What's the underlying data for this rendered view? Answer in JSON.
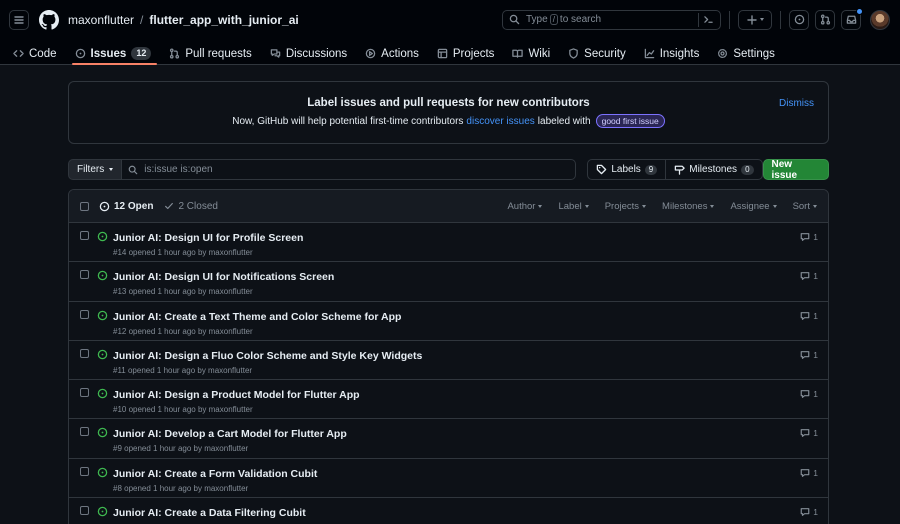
{
  "header": {
    "owner": "maxonflutter",
    "separator": "/",
    "repo": "flutter_app_with_junior_ai",
    "search": {
      "prefix": "Type",
      "key": "/",
      "suffix": "to search"
    }
  },
  "nav": {
    "tabs": [
      {
        "label": "Code"
      },
      {
        "label": "Issues",
        "count": "12"
      },
      {
        "label": "Pull requests"
      },
      {
        "label": "Discussions"
      },
      {
        "label": "Actions"
      },
      {
        "label": "Projects"
      },
      {
        "label": "Wiki"
      },
      {
        "label": "Security"
      },
      {
        "label": "Insights"
      },
      {
        "label": "Settings"
      }
    ]
  },
  "banner": {
    "title": "Label issues and pull requests for new contributors",
    "text_before": "Now, GitHub will help potential first-time contributors",
    "link": "discover issues",
    "text_after": "labeled with",
    "label": "good first issue",
    "dismiss": "Dismiss"
  },
  "filterbar": {
    "filters": "Filters",
    "query": "is:issue is:open",
    "labels": "Labels",
    "labels_count": "9",
    "milestones": "Milestones",
    "milestones_count": "0",
    "new_issue": "New issue"
  },
  "list": {
    "open": "12 Open",
    "closed": "2 Closed",
    "sorts": [
      "Author",
      "Label",
      "Projects",
      "Milestones",
      "Assignee",
      "Sort"
    ],
    "issues": [
      {
        "title": "Junior AI: Design UI for Profile Screen",
        "meta": "#14 opened 1 hour ago by maxonflutter",
        "comments": "1"
      },
      {
        "title": "Junior AI: Design UI for Notifications Screen",
        "meta": "#13 opened 1 hour ago by maxonflutter",
        "comments": "1"
      },
      {
        "title": "Junior AI: Create a Text Theme and Color Scheme for App",
        "meta": "#12 opened 1 hour ago by maxonflutter",
        "comments": "1"
      },
      {
        "title": "Junior AI: Design a Fluo Color Scheme and Style Key Widgets",
        "meta": "#11 opened 1 hour ago by maxonflutter",
        "comments": "1"
      },
      {
        "title": "Junior AI: Design a Product Model for Flutter App",
        "meta": "#10 opened 1 hour ago by maxonflutter",
        "comments": "1"
      },
      {
        "title": "Junior AI: Develop a Cart Model for Flutter App",
        "meta": "#9 opened 1 hour ago by maxonflutter",
        "comments": "1"
      },
      {
        "title": "Junior AI: Create a Form Validation Cubit",
        "meta": "#8 opened 1 hour ago by maxonflutter",
        "comments": "1"
      },
      {
        "title": "Junior AI: Create a Data Filtering Cubit",
        "meta": "",
        "comments": "1"
      }
    ]
  },
  "colors": {
    "open_icon": "#3fb950",
    "primary_button": "#238636",
    "link": "#4493f8",
    "active_tab": "#f78166"
  }
}
